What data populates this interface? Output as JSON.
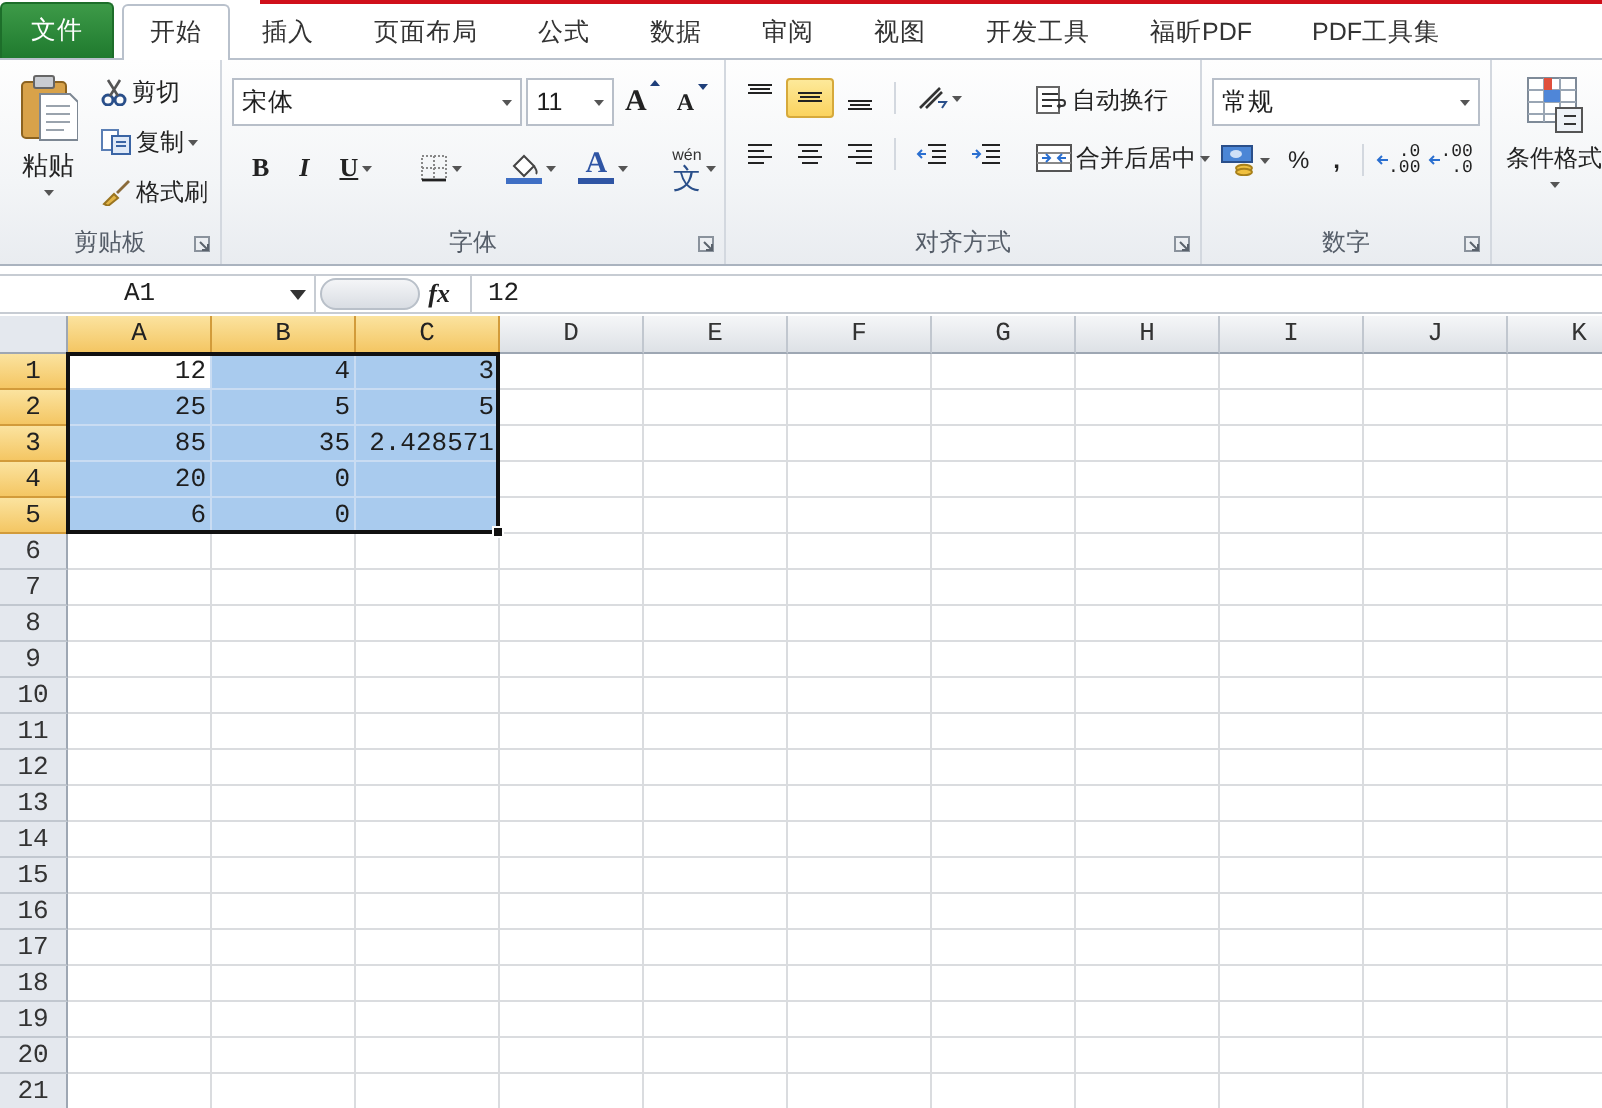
{
  "tabs": [
    {
      "label": "文件",
      "kind": "file",
      "selected": false
    },
    {
      "label": "开始",
      "kind": "tab",
      "selected": true
    },
    {
      "label": "插入",
      "kind": "tab",
      "selected": false
    },
    {
      "label": "页面布局",
      "kind": "tab",
      "selected": false
    },
    {
      "label": "公式",
      "kind": "tab",
      "selected": false
    },
    {
      "label": "数据",
      "kind": "tab",
      "selected": false
    },
    {
      "label": "审阅",
      "kind": "tab",
      "selected": false
    },
    {
      "label": "视图",
      "kind": "tab",
      "selected": false
    },
    {
      "label": "开发工具",
      "kind": "tab",
      "selected": false
    },
    {
      "label": "福昕PDF",
      "kind": "tab",
      "selected": false
    },
    {
      "label": "PDF工具集",
      "kind": "tab",
      "selected": false
    }
  ],
  "ribbon": {
    "clipboard": {
      "label": "剪贴板",
      "paste": "粘贴",
      "cut": "剪切",
      "copy": "复制",
      "format_painter": "格式刷"
    },
    "font": {
      "label": "字体",
      "font_name": "宋体",
      "font_size": "11",
      "size_buttons": [
        {
          "kind": "grow",
          "label": "A"
        },
        {
          "kind": "shrink",
          "label": "A"
        }
      ],
      "style_buttons": [
        {
          "kind": "bold",
          "label": "B"
        },
        {
          "kind": "italic",
          "label": "I"
        },
        {
          "kind": "underline",
          "label": "U"
        }
      ],
      "font_color": {
        "label": "A",
        "color": "#2f55a4"
      },
      "fill_color": {
        "color": "#3f6fc4"
      },
      "phonetic": {
        "top": "wén",
        "main": "文"
      }
    },
    "alignment": {
      "label": "对齐方式",
      "wrap_text": "自动换行",
      "merge_center": "合并后居中",
      "buttons": [
        {
          "kind": "top",
          "selected": false
        },
        {
          "kind": "middle",
          "selected": true
        },
        {
          "kind": "bottom",
          "selected": false
        },
        {
          "kind": "orientation",
          "selected": false
        },
        {
          "kind": "left",
          "selected": false
        },
        {
          "kind": "center",
          "selected": false
        },
        {
          "kind": "right",
          "selected": false
        },
        {
          "kind": "outdent",
          "selected": false
        },
        {
          "kind": "indent",
          "selected": false
        }
      ]
    },
    "number": {
      "label": "数字",
      "format": "常规",
      "buttons": [
        {
          "kind": "currency"
        },
        {
          "kind": "percent",
          "label": "%"
        },
        {
          "kind": "comma",
          "label": ","
        },
        {
          "kind": "decimal",
          "lines": [
            ".0",
            ".00"
          ]
        },
        {
          "kind": "decimal",
          "lines": [
            ".00",
            ".0"
          ]
        }
      ]
    },
    "styles": {
      "conditional_format": "条件格式"
    }
  },
  "formula_bar": {
    "name_box": "A1",
    "fx": "fx",
    "formula": "12"
  },
  "sheet": {
    "columns": [
      {
        "label": "A",
        "selected": true
      },
      {
        "label": "B",
        "selected": true
      },
      {
        "label": "C",
        "selected": true
      },
      {
        "label": "D",
        "selected": false
      },
      {
        "label": "E",
        "selected": false
      },
      {
        "label": "F",
        "selected": false
      },
      {
        "label": "G",
        "selected": false
      },
      {
        "label": "H",
        "selected": false
      },
      {
        "label": "I",
        "selected": false
      },
      {
        "label": "J",
        "selected": false
      },
      {
        "label": "K",
        "selected": false
      }
    ],
    "rows": [
      {
        "label": "1",
        "selected": true,
        "cells": [
          {
            "value": "12",
            "selected": true,
            "active": true
          },
          {
            "value": "4",
            "selected": true,
            "active": false
          },
          {
            "value": "3",
            "selected": true,
            "active": false
          }
        ]
      },
      {
        "label": "2",
        "selected": true,
        "cells": [
          {
            "value": "25",
            "selected": true,
            "active": false
          },
          {
            "value": "5",
            "selected": true,
            "active": false
          },
          {
            "value": "5",
            "selected": true,
            "active": false
          }
        ]
      },
      {
        "label": "3",
        "selected": true,
        "cells": [
          {
            "value": "85",
            "selected": true,
            "active": false
          },
          {
            "value": "35",
            "selected": true,
            "active": false
          },
          {
            "value": "2.428571",
            "selected": true,
            "active": false
          }
        ]
      },
      {
        "label": "4",
        "selected": true,
        "cells": [
          {
            "value": "20",
            "selected": true,
            "active": false
          },
          {
            "value": "0",
            "selected": true,
            "active": false
          },
          {
            "selected": true,
            "active": false
          }
        ]
      },
      {
        "label": "5",
        "selected": true,
        "cells": [
          {
            "value": "6",
            "selected": true,
            "active": false
          },
          {
            "value": "0",
            "selected": true,
            "active": false
          },
          {
            "selected": true,
            "active": false
          }
        ]
      },
      {
        "label": "6",
        "selected": false
      },
      {
        "label": "7",
        "selected": false
      },
      {
        "label": "8",
        "selected": false
      },
      {
        "label": "9",
        "selected": false
      },
      {
        "label": "10",
        "selected": false
      },
      {
        "label": "11",
        "selected": false
      },
      {
        "label": "12",
        "selected": false
      },
      {
        "label": "13",
        "selected": false
      },
      {
        "label": "14",
        "selected": false
      },
      {
        "label": "15",
        "selected": false
      },
      {
        "label": "16",
        "selected": false
      },
      {
        "label": "17",
        "selected": false
      },
      {
        "label": "18",
        "selected": false
      },
      {
        "label": "19",
        "selected": false
      },
      {
        "label": "20",
        "selected": false
      },
      {
        "label": "21",
        "selected": false
      }
    ]
  }
}
